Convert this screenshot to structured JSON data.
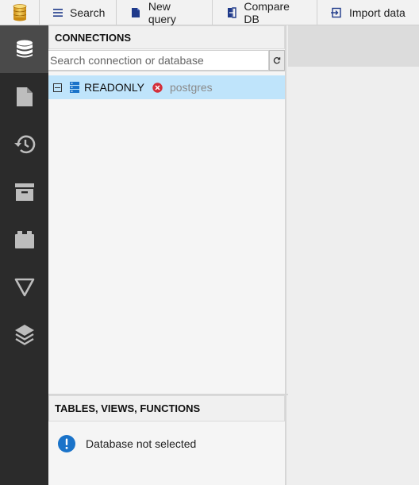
{
  "toolbar": {
    "app_icon": "database-stack-icon",
    "buttons": [
      {
        "label": "Search",
        "icon": "hamburger-icon"
      },
      {
        "label": "New query",
        "icon": "document-icon"
      },
      {
        "label": "Compare DB",
        "icon": "compare-icon"
      },
      {
        "label": "Import data",
        "icon": "import-icon"
      }
    ]
  },
  "sidebar": {
    "items": [
      {
        "icon": "database-icon",
        "active": true
      },
      {
        "icon": "file-icon",
        "active": false
      },
      {
        "icon": "history-icon",
        "active": false
      },
      {
        "icon": "archive-icon",
        "active": false
      },
      {
        "icon": "plugin-icon",
        "active": false
      },
      {
        "icon": "filter-icon",
        "active": false
      },
      {
        "icon": "layers-icon",
        "active": false
      }
    ]
  },
  "connections": {
    "title": "CONNECTIONS",
    "search_placeholder": "Search connection or database",
    "items": [
      {
        "name": "READONLY",
        "status": "error",
        "database": "postgres"
      }
    ]
  },
  "tables": {
    "title": "TABLES, VIEWS, FUNCTIONS",
    "message": "Database not selected"
  },
  "colors": {
    "sidebar_bg": "#2b2b2b",
    "sidebar_active": "#4a4a4a",
    "selected_row": "#bfe4fb",
    "accent_blue": "#1a73c9",
    "error_red": "#d32f3a"
  }
}
